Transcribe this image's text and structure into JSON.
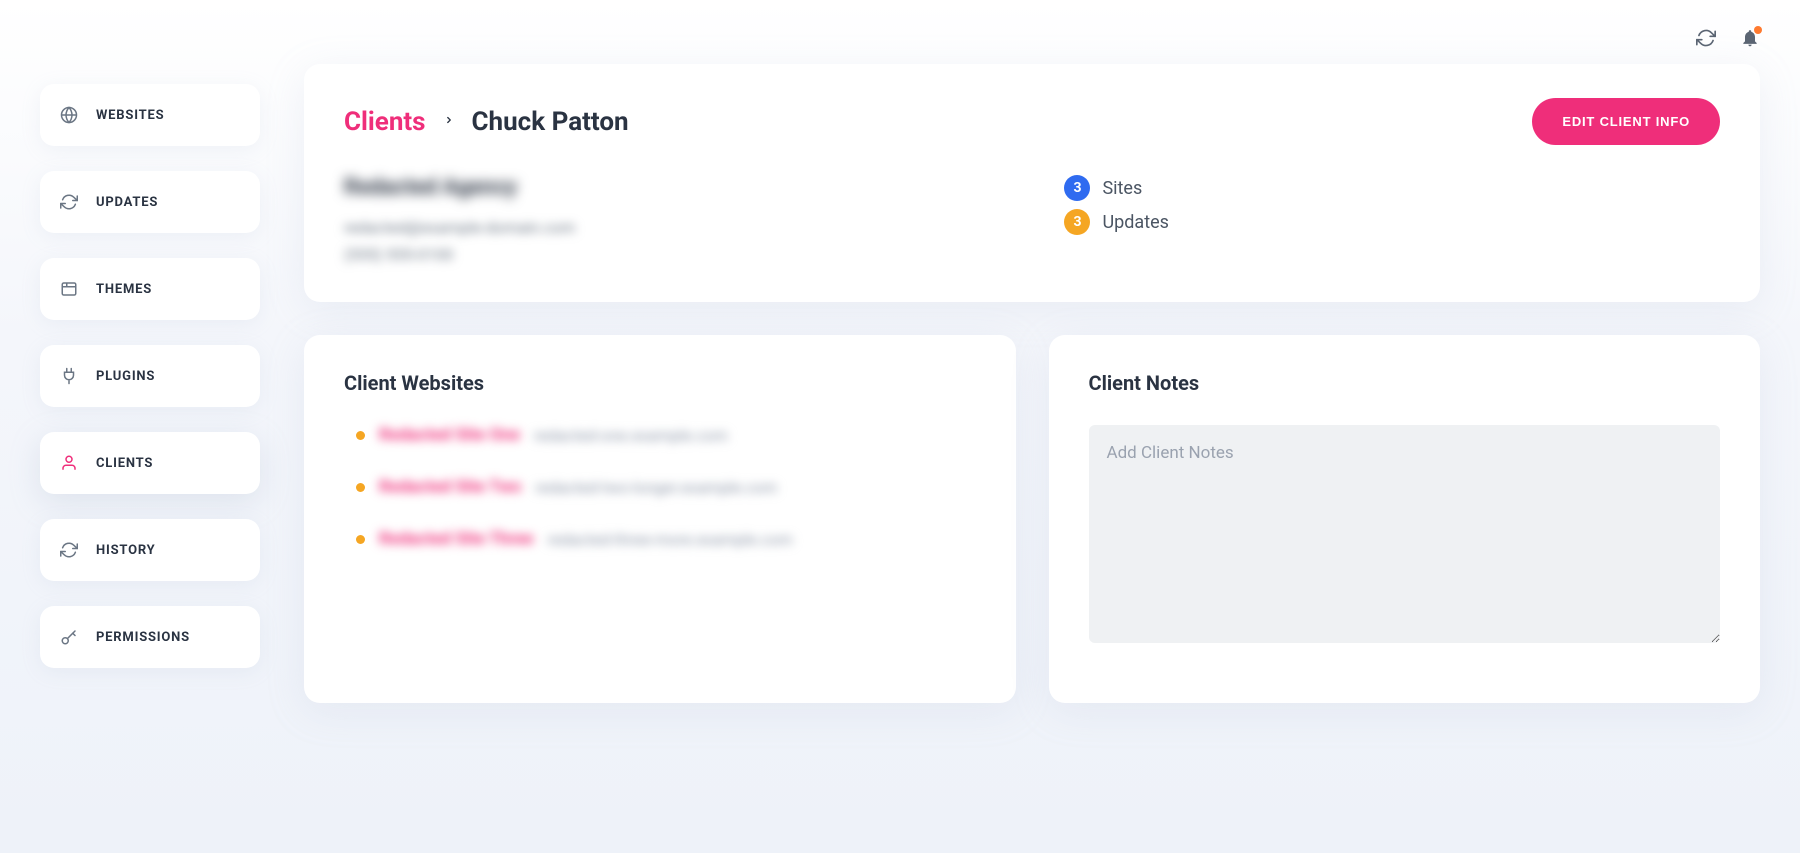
{
  "topbar": {
    "refresh_label": "Refresh",
    "notifications_label": "Notifications"
  },
  "sidebar": {
    "items": [
      {
        "id": "websites",
        "label": "WEBSITES",
        "icon": "globe"
      },
      {
        "id": "updates",
        "label": "UPDATES",
        "icon": "refresh"
      },
      {
        "id": "themes",
        "label": "THEMES",
        "icon": "window"
      },
      {
        "id": "plugins",
        "label": "PLUGINS",
        "icon": "plug"
      },
      {
        "id": "clients",
        "label": "CLIENTS",
        "icon": "user",
        "active": true
      },
      {
        "id": "history",
        "label": "HISTORY",
        "icon": "refresh"
      },
      {
        "id": "permissions",
        "label": "PERMISSIONS",
        "icon": "key"
      }
    ]
  },
  "breadcrumb": {
    "root": "Clients",
    "current": "Chuck Patton"
  },
  "header": {
    "edit_button": "EDIT CLIENT INFO",
    "client_name_blurred": "Redacted Agency",
    "client_email_blurred": "redacted@example-domain.com",
    "client_phone_blurred": "(555) 555-0100"
  },
  "stats": {
    "sites": {
      "count": "3",
      "label": "Sites",
      "color": "blue"
    },
    "updates": {
      "count": "3",
      "label": "Updates",
      "color": "orange"
    }
  },
  "client_websites": {
    "title": "Client Websites",
    "items": [
      {
        "name": "Redacted Site One",
        "url": "redacted-one.example.com"
      },
      {
        "name": "Redacted Site Two",
        "url": "redacted-two-longer.example.com"
      },
      {
        "name": "Redacted Site Three",
        "url": "redacted-three-more.example.com"
      }
    ]
  },
  "client_notes": {
    "title": "Client Notes",
    "placeholder": "Add Client Notes",
    "value": ""
  }
}
